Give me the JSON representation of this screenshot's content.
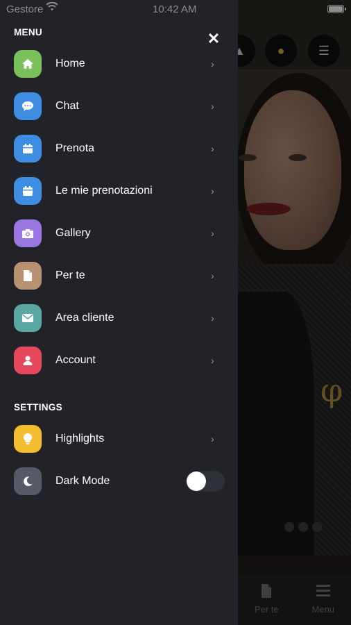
{
  "status_bar": {
    "carrier": "Gestore",
    "time": "10:42 AM"
  },
  "drawer": {
    "menu_title": "MENU",
    "settings_title": "SETTINGS",
    "items": [
      {
        "label": "Home",
        "icon": "home-icon",
        "color": "#7bc15a"
      },
      {
        "label": "Chat",
        "icon": "chat-icon",
        "color": "#3e8de3"
      },
      {
        "label": "Prenota",
        "icon": "calendar-icon",
        "color": "#3e8de3"
      },
      {
        "label": "Le mie prenotazioni",
        "icon": "calendar-icon",
        "color": "#3e8de3"
      },
      {
        "label": "Gallery",
        "icon": "camera-icon",
        "color": "#9a77e0"
      },
      {
        "label": "Per te",
        "icon": "document-icon",
        "color": "#b79272"
      },
      {
        "label": "Area cliente",
        "icon": "mail-icon",
        "color": "#5aa7a2"
      },
      {
        "label": "Account",
        "icon": "user-icon",
        "color": "#e5485d"
      }
    ],
    "settings": [
      {
        "label": "Highlights",
        "icon": "lightbulb-icon",
        "color": "#f4bd2f"
      },
      {
        "label": "Dark Mode",
        "icon": "moon-icon",
        "color": "#555a66",
        "toggle_on": false
      }
    ]
  },
  "background_tabs": [
    {
      "label": "Per te",
      "icon": "document-icon"
    },
    {
      "label": "Menu",
      "icon": "hamburger-icon"
    }
  ]
}
